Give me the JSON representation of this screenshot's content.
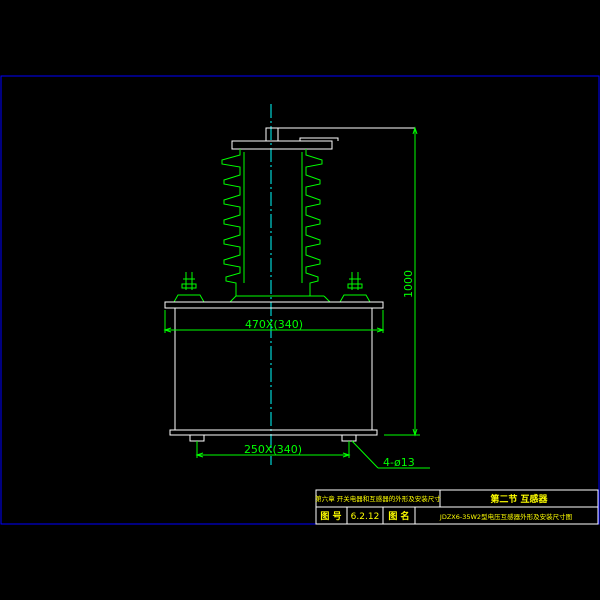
{
  "drawing": {
    "dimensions": {
      "height": "1000",
      "width": "470X(340)",
      "base": "250X(340)",
      "holes": "4-ø13"
    },
    "title_block": {
      "chapter": "第六章 开关电器和互感器的外形及安装尺寸",
      "section": "第二节 互感器",
      "figure_no_label": "图 号",
      "figure_no": "6.2.12",
      "figure_name_label": "图 名",
      "figure_name": "JDZX6-35W2型电压互感器外形及安装尺寸图"
    },
    "colors": {
      "frame": "#0000ff",
      "insulator": "#00ff00",
      "body": "#ffffff",
      "dimension": "#00ff00",
      "centerline": "#00ffff",
      "title_text": "#ffff00"
    }
  }
}
